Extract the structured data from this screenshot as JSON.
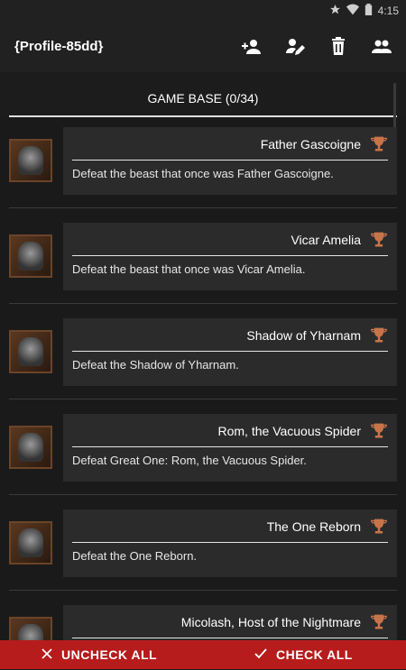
{
  "statusbar": {
    "time": "4:15"
  },
  "appbar": {
    "title": "{Profile-85dd}",
    "actions": [
      "add-person-icon",
      "edit-icon",
      "delete-icon",
      "group-icon"
    ]
  },
  "tabs": [
    {
      "label": "GAME BASE (0/34)"
    }
  ],
  "trophies": [
    {
      "name": "Father Gascoigne",
      "description": "Defeat the beast that once was Father Gascoigne."
    },
    {
      "name": "Vicar Amelia",
      "description": "Defeat the beast that once was Vicar Amelia."
    },
    {
      "name": "Shadow of Yharnam",
      "description": "Defeat the Shadow of Yharnam."
    },
    {
      "name": "Rom, the Vacuous Spider",
      "description": "Defeat Great One: Rom, the Vacuous Spider."
    },
    {
      "name": "The One Reborn",
      "description": "Defeat the One Reborn."
    },
    {
      "name": "Micolash, Host of the Nightmare",
      "description": ""
    }
  ],
  "bottom": {
    "uncheck_label": "UNCHECK ALL",
    "check_label": "CHECK ALL"
  },
  "colors": {
    "accent": "#b71c1c",
    "trophy": "#c8744a"
  }
}
